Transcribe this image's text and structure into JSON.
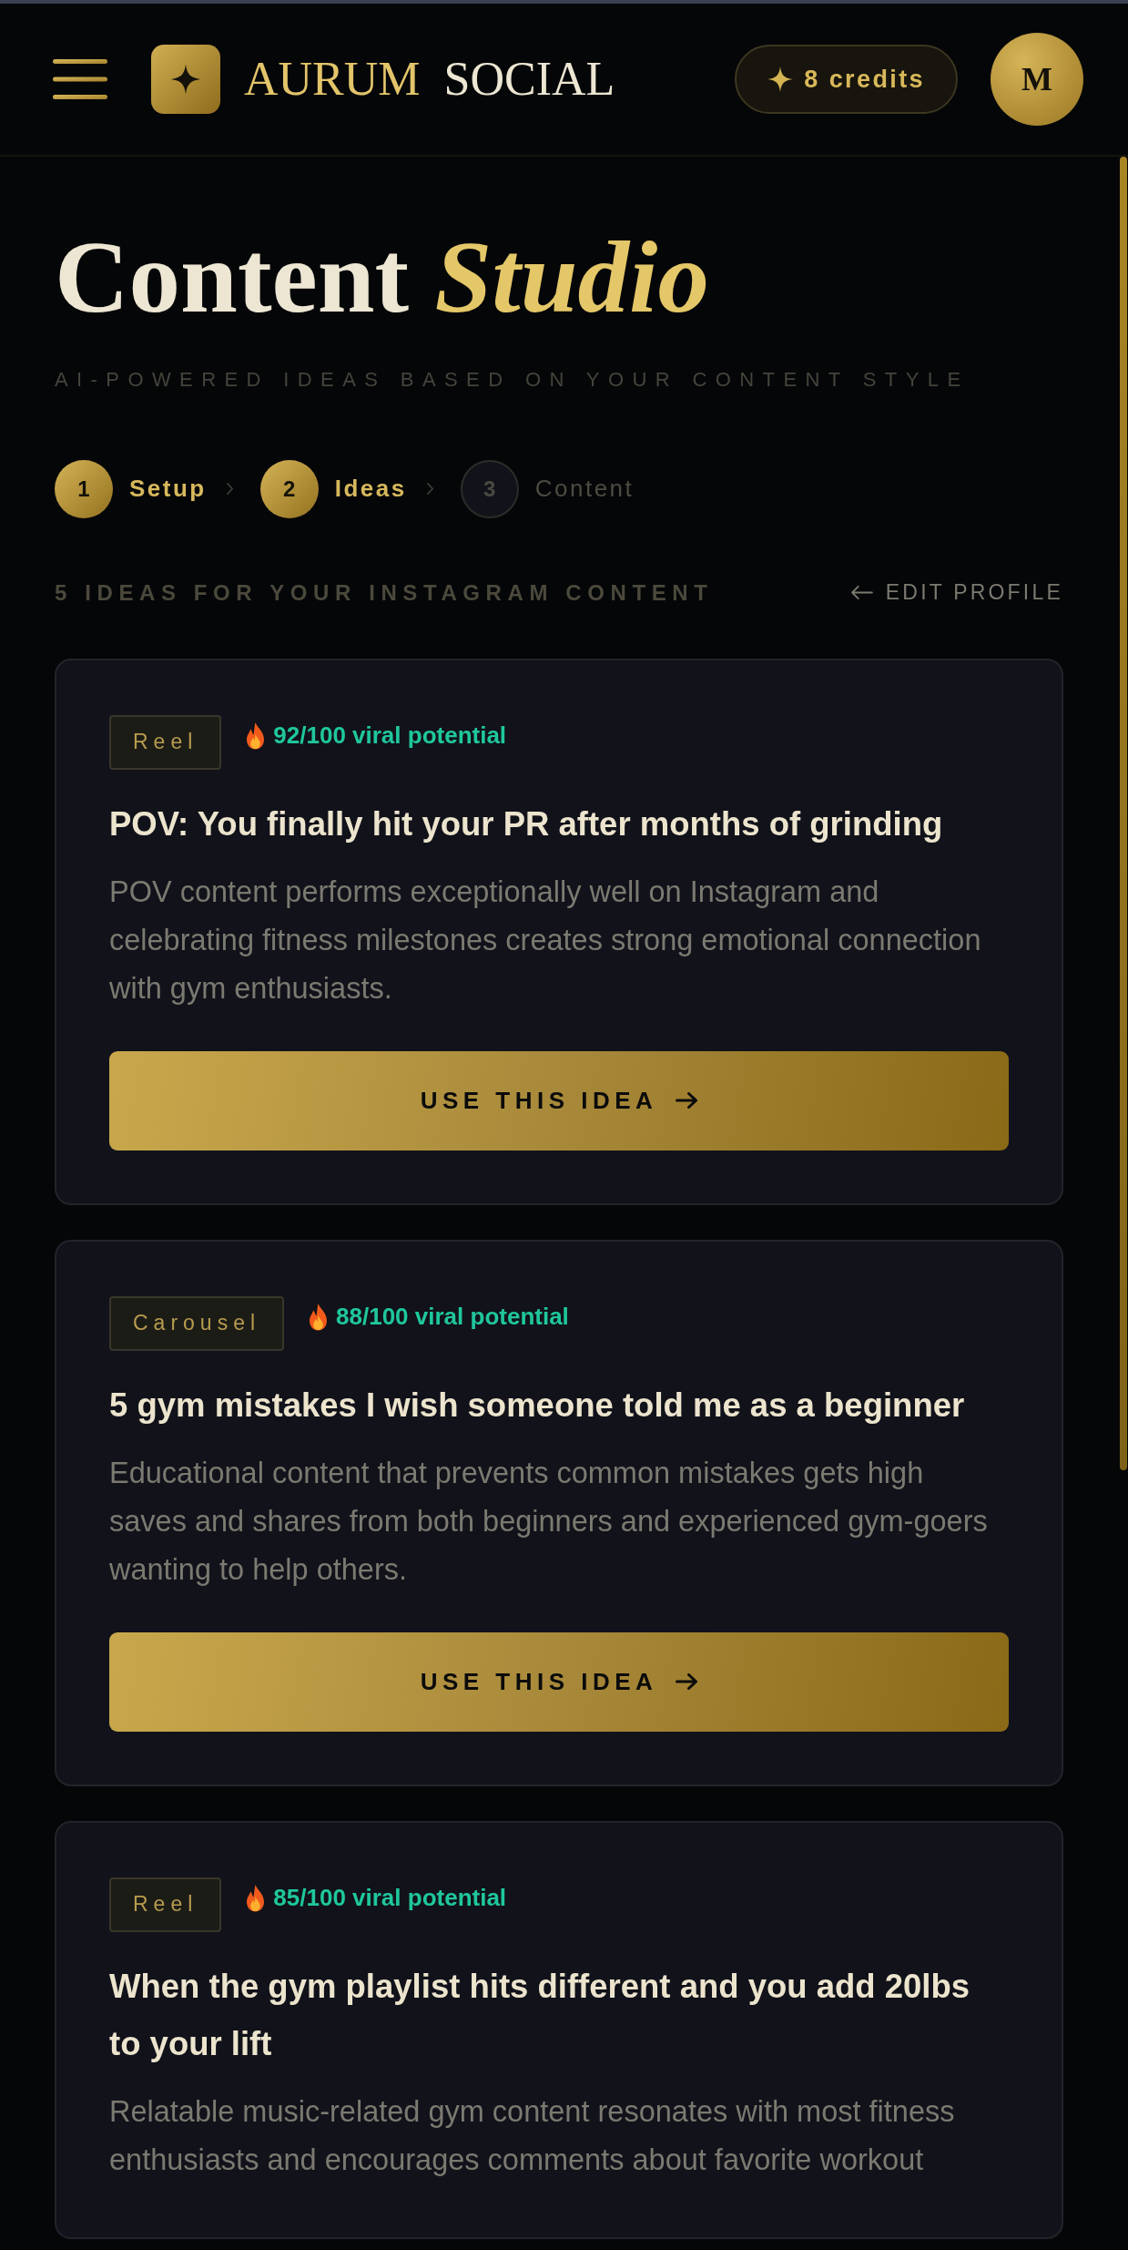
{
  "header": {
    "brand_primary": "AURUM",
    "brand_secondary": "SOCIAL",
    "credits": "8 credits",
    "avatar_initial": "M"
  },
  "intro": {
    "title": "Content",
    "title_accent": "Studio",
    "subtitle": "AI-POWERED IDEAS BASED ON YOUR CONTENT STYLE"
  },
  "steps": [
    {
      "number": "1",
      "label": "Setup",
      "active": true
    },
    {
      "number": "2",
      "label": "Ideas",
      "active": true
    },
    {
      "number": "3",
      "label": "Content",
      "active": false
    }
  ],
  "ideas_bar": {
    "heading": "5 IDEAS FOR YOUR INSTAGRAM CONTENT",
    "edit_link": "EDIT PROFILE"
  },
  "ideas": [
    {
      "format": "Reel",
      "score": "92/100 viral potential",
      "title": "POV: You finally hit your PR after months of grinding",
      "description": "POV content performs exceptionally well on Instagram and celebrating fitness milestones creates strong emotional connection with gym enthusiasts.",
      "button": "USE THIS IDEA"
    },
    {
      "format": "Carousel",
      "score": "88/100 viral potential",
      "title": "5 gym mistakes I wish someone told me as a beginner",
      "description": "Educational content that prevents common mistakes gets high saves and shares from both beginners and experienced gym-goers wanting to help others.",
      "button": "USE THIS IDEA"
    },
    {
      "format": "Reel",
      "score": "85/100 viral potential",
      "title": "When the gym playlist hits different and you add 20lbs to your lift",
      "description": "Relatable music-related gym content resonates with most fitness enthusiasts and encourages comments about favorite workout"
    }
  ]
}
